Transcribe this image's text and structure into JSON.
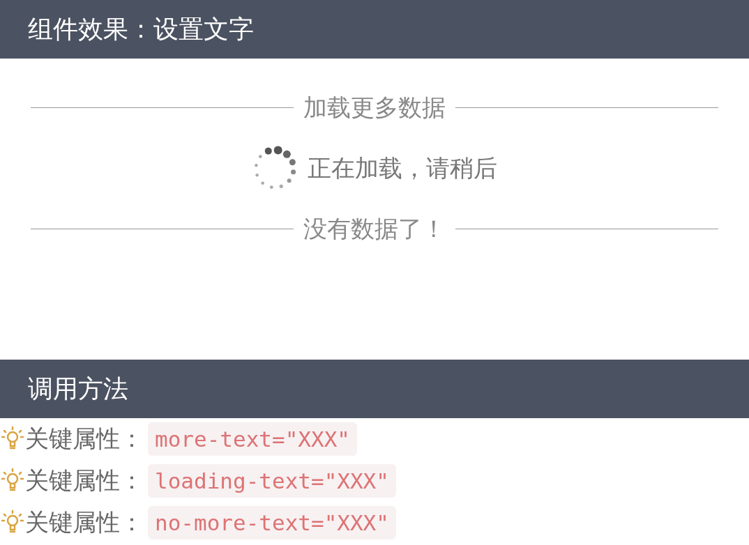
{
  "header": {
    "title": "组件效果：设置文字"
  },
  "demo": [
    {
      "kind": "divider",
      "text": "加载更多数据"
    },
    {
      "kind": "loading",
      "text": "正在加载，请稍后"
    },
    {
      "kind": "divider",
      "text": "没有数据了！"
    }
  ],
  "usage": {
    "title": "调用方法",
    "items": [
      {
        "label": "关键属性：",
        "code": "more-text=\"XXX\""
      },
      {
        "label": "关键属性：",
        "code": "loading-text=\"XXX\""
      },
      {
        "label": "关键属性：",
        "code": "no-more-text=\"XXX\""
      }
    ]
  }
}
